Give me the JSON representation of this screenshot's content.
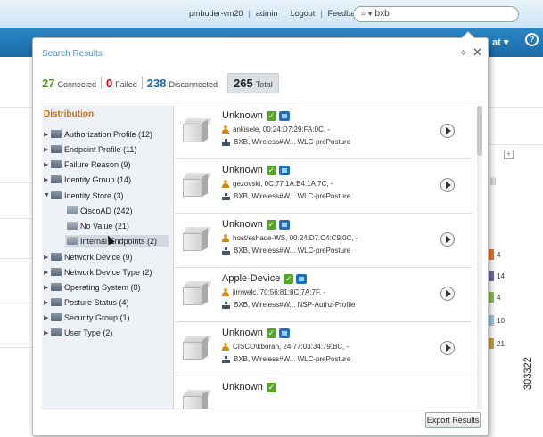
{
  "topbar": {
    "links": [
      "pmbuder-vm20",
      "admin",
      "Logout",
      "Feedback"
    ],
    "search_value": "bxb"
  },
  "nav": {
    "right_text": "at"
  },
  "popup": {
    "title": "Search Results",
    "stats": [
      {
        "count": "27",
        "label": "Connected",
        "color": "#4a9a16"
      },
      {
        "count": "0",
        "label": "Failed",
        "color": "#cc0000"
      },
      {
        "count": "238",
        "label": "Disconnected",
        "color": "#1a6db5"
      },
      {
        "count": "265",
        "label": "Total",
        "color": "#222222"
      }
    ],
    "distribution": {
      "title": "Distribution",
      "items": [
        {
          "label": "Authorization Profile (12)",
          "expanded": false
        },
        {
          "label": "Endpoint Profile (11)",
          "expanded": false
        },
        {
          "label": "Failure Reason (9)",
          "expanded": false
        },
        {
          "label": "Identity Group (14)",
          "expanded": false
        },
        {
          "label": "Identity Store (3)",
          "expanded": true
        },
        {
          "label": "CiscoAD (242)",
          "sub": true
        },
        {
          "label": "No Value (21)",
          "sub": true
        },
        {
          "label": "Internal Endpoints (2)",
          "sub": true,
          "selected": true
        },
        {
          "label": "Network Device (9)",
          "expanded": false
        },
        {
          "label": "Network Device Type (2)",
          "expanded": false
        },
        {
          "label": "Operating System (8)",
          "expanded": false
        },
        {
          "label": "Posture Status (4)",
          "expanded": false
        },
        {
          "label": "Security Group (1)",
          "expanded": false
        },
        {
          "label": "User Type (2)",
          "expanded": false
        }
      ]
    },
    "results": [
      {
        "name": "Unknown",
        "line1": "ankisele, 00:24:D7:29:FA:0C, -",
        "line2": "BXB, Wireless#W...  WLC-prePosture"
      },
      {
        "name": "Unknown",
        "line1": "gezovski, 0C:77:1A:B4:1A:7C, -",
        "line2": "BXB, Wireless#W...  WLC-prePosture"
      },
      {
        "name": "Unknown",
        "line1": "host/eshade-WS, 00:24:D7:C4:C9:0C, -",
        "line2": "BXB, Wireless#W...  WLC-prePosture"
      },
      {
        "name": "Apple-Device",
        "line1": "jimwelc, 70:56:81:8C:7A:7F, -",
        "line2": "BXB, Wireless#W...  NSP-Authz-Profile"
      },
      {
        "name": "Unknown",
        "line1": "CISCO\\kboran, 24:77:03:34:79:BC, -",
        "line2": "BXB, Wireless#W...  WLC-prePosture"
      }
    ],
    "partial_result_name": "Unknown",
    "export_label": "Export Results"
  },
  "background": {
    "right_numbers": [
      "4",
      "14",
      "4",
      "10",
      "21"
    ],
    "chip_colors": [
      "#e8742a",
      "#7a6aa8",
      "#8cc04a",
      "#9dc8e8",
      "#c9a040"
    ]
  },
  "figure_id": "303322"
}
